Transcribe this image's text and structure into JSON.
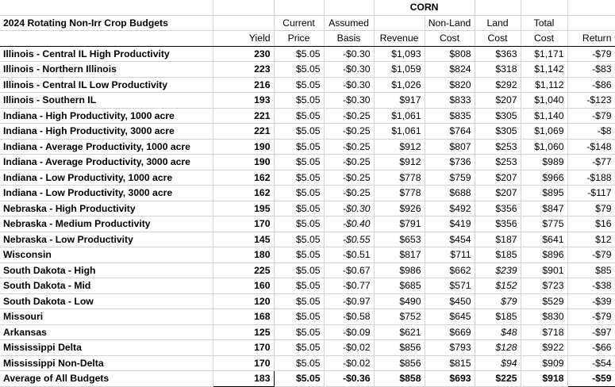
{
  "sheet": {
    "title": "2024 Rotating Non-Irr Crop Budgets",
    "crop": "CORN",
    "headers_top": [
      "",
      "Current",
      "Assumed",
      "",
      "Non-Land",
      "Land",
      "Total",
      ""
    ],
    "headers_bottom": [
      "Yield",
      "Price",
      "Basis",
      "Revenue",
      "Cost",
      "Cost",
      "Cost",
      "Return"
    ],
    "rows": [
      {
        "name": "Illinois - Central IL High Productivity",
        "yield": "230",
        "price": "$5.05",
        "basis": "-$0.30",
        "revenue": "$1,093",
        "nonland": "$808",
        "land": "$363",
        "total": "$1,171",
        "ret": "-$79"
      },
      {
        "name": "Illinois - Northern Illinois",
        "yield": "223",
        "price": "$5.05",
        "basis": "-$0.30",
        "revenue": "$1,059",
        "nonland": "$824",
        "land": "$318",
        "total": "$1,142",
        "ret": "-$83"
      },
      {
        "name": "Illinois - Central IL Low Productivity",
        "yield": "216",
        "price": "$5.05",
        "basis": "-$0.30",
        "revenue": "$1,026",
        "nonland": "$820",
        "land": "$292",
        "total": "$1,112",
        "ret": "-$86"
      },
      {
        "name": "Illinois - Southern IL",
        "yield": "193",
        "price": "$5.05",
        "basis": "-$0.30",
        "revenue": "$917",
        "nonland": "$833",
        "land": "$207",
        "total": "$1,040",
        "ret": "-$123"
      },
      {
        "name": "Indiana - High Productivity, 1000 acre",
        "yield": "221",
        "price": "$5.05",
        "basis": "-$0.25",
        "revenue": "$1,061",
        "nonland": "$835",
        "land": "$305",
        "total": "$1,140",
        "ret": "-$79"
      },
      {
        "name": "Indiana - High Productivity, 3000 acre",
        "yield": "221",
        "price": "$5.05",
        "basis": "-$0.25",
        "revenue": "$1,061",
        "nonland": "$764",
        "land": "$305",
        "total": "$1,069",
        "ret": "-$8"
      },
      {
        "name": "Indiana - Average Productivity, 1000 acre",
        "yield": "190",
        "price": "$5.05",
        "basis": "-$0.25",
        "revenue": "$912",
        "nonland": "$807",
        "land": "$253",
        "total": "$1,060",
        "ret": "-$148"
      },
      {
        "name": "Indiana - Average Productivity, 3000 acre",
        "yield": "190",
        "price": "$5.05",
        "basis": "-$0.25",
        "revenue": "$912",
        "nonland": "$736",
        "land": "$253",
        "total": "$989",
        "ret": "-$77"
      },
      {
        "name": "Indiana - Low Productivity, 1000 acre",
        "yield": "162",
        "price": "$5.05",
        "basis": "-$0.25",
        "revenue": "$778",
        "nonland": "$759",
        "land": "$207",
        "total": "$966",
        "ret": "-$188"
      },
      {
        "name": "Indiana - Low Productivity, 3000 acre",
        "yield": "162",
        "price": "$5.05",
        "basis": "-$0.25",
        "revenue": "$778",
        "nonland": "$688",
        "land": "$207",
        "total": "$895",
        "ret": "-$117"
      },
      {
        "name": "Nebraska - High Productivity",
        "yield": "195",
        "price": "$5.05",
        "basis": "-$0.30",
        "revenue": "$926",
        "nonland": "$492",
        "land": "$356",
        "total": "$847",
        "ret": "$79",
        "basis_italic": true
      },
      {
        "name": "Nebraska - Medium Productivity",
        "yield": "170",
        "price": "$5.05",
        "basis": "-$0.40",
        "revenue": "$791",
        "nonland": "$419",
        "land": "$356",
        "total": "$775",
        "ret": "$16",
        "basis_italic": true
      },
      {
        "name": "Nebraska - Low Productivity",
        "yield": "145",
        "price": "$5.05",
        "basis": "-$0.55",
        "revenue": "$653",
        "nonland": "$454",
        "land": "$187",
        "total": "$641",
        "ret": "$12",
        "basis_italic": true
      },
      {
        "name": "Wisconsin",
        "yield": "180",
        "price": "$5.05",
        "basis": "-$0.51",
        "revenue": "$817",
        "nonland": "$711",
        "land": "$185",
        "total": "$896",
        "ret": "-$79"
      },
      {
        "name": "South Dakota - High",
        "yield": "225",
        "price": "$5.05",
        "basis": "-$0.67",
        "revenue": "$986",
        "nonland": "$662",
        "land": "$239",
        "total": "$901",
        "ret": "$85",
        "land_italic": true
      },
      {
        "name": "South Dakota - Mid",
        "yield": "160",
        "price": "$5.05",
        "basis": "-$0.77",
        "revenue": "$685",
        "nonland": "$571",
        "land": "$152",
        "total": "$723",
        "ret": "-$38",
        "land_italic": true
      },
      {
        "name": "South Dakota -   Low",
        "yield": "120",
        "price": "$5.05",
        "basis": "-$0.97",
        "revenue": "$490",
        "nonland": "$450",
        "land": "$79",
        "total": "$529",
        "ret": "-$39",
        "land_italic": true
      },
      {
        "name": "Missouri",
        "yield": "168",
        "price": "$5.05",
        "basis": "-$0.58",
        "revenue": "$752",
        "nonland": "$645",
        "land": "$185",
        "total": "$830",
        "ret": "-$79"
      },
      {
        "name": "Arkansas",
        "yield": "125",
        "price": "$5.05",
        "basis": "-$0.09",
        "revenue": "$621",
        "nonland": "$669",
        "land": "$48",
        "total": "$718",
        "ret": "-$97",
        "land_italic": true
      },
      {
        "name": "Mississippi Delta",
        "yield": "170",
        "price": "$5.05",
        "basis": "-$0.02",
        "revenue": "$856",
        "nonland": "$793",
        "land": "$128",
        "total": "$922",
        "ret": "-$66",
        "land_italic": true
      },
      {
        "name": "Mississippi Non-Delta",
        "yield": "170",
        "price": "$5.05",
        "basis": "-$0.02",
        "revenue": "$856",
        "nonland": "$815",
        "land": "$94",
        "total": "$909",
        "ret": "-$54",
        "land_italic": true
      }
    ],
    "average": {
      "name": "Average of All Budgets",
      "yield": "183",
      "price": "$5.05",
      "basis": "-$0.36",
      "revenue": "$858",
      "nonland": "$693",
      "land": "$225",
      "total": "$918",
      "ret": "-$59"
    }
  }
}
